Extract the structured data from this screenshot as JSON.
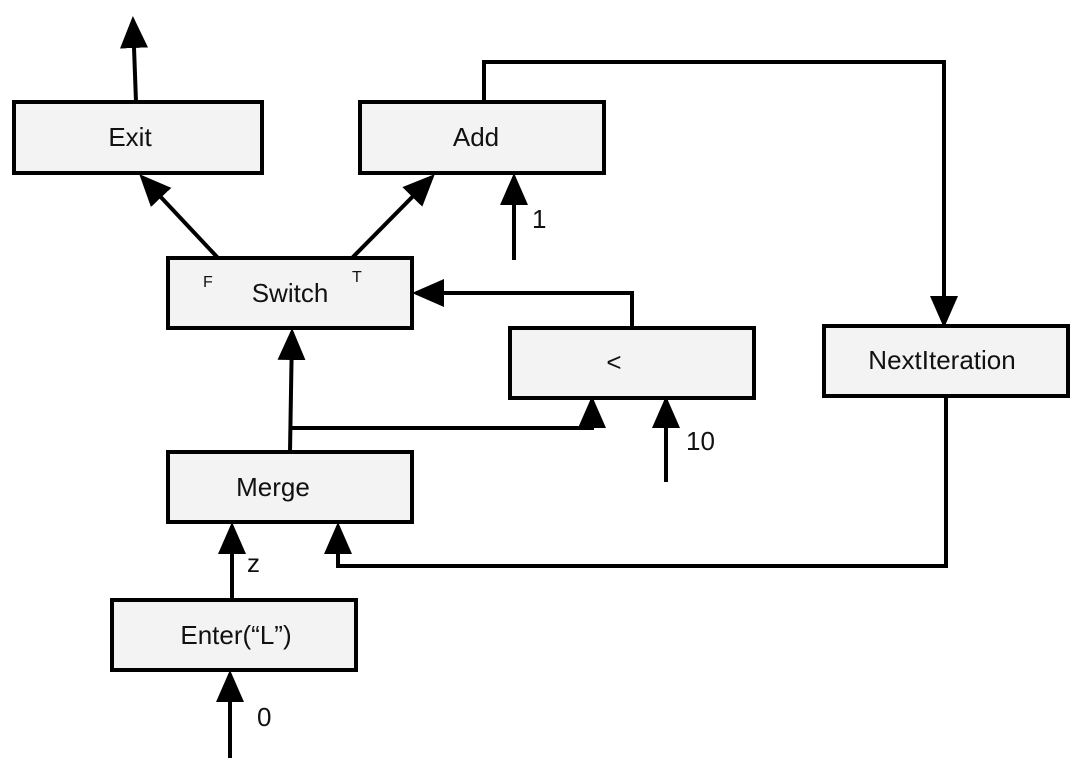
{
  "nodes": {
    "exit": "Exit",
    "add": "Add",
    "switch": "Switch",
    "switch_false_port": "F",
    "switch_true_port": "T",
    "less": "<",
    "next_iteration": "NextIteration",
    "merge": "Merge",
    "enter": "Enter(“L”)"
  },
  "edge_labels": {
    "add_const": "1",
    "less_const": "10",
    "enter_to_merge": "z",
    "enter_input": "0"
  },
  "colors": {
    "node_fill": "#f3f3f3",
    "stroke": "#000000"
  }
}
